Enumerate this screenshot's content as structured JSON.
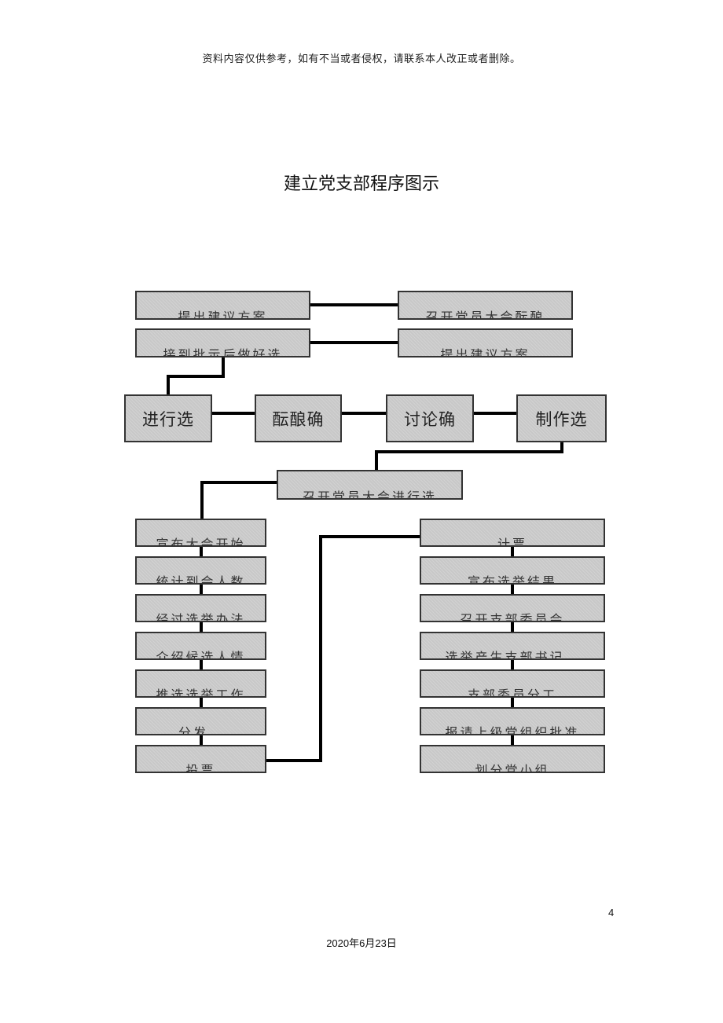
{
  "header_note": "资料内容仅供参考，如有不当或者侵权，请联系本人改正或者删除。",
  "title": "建立党支部程序图示",
  "flowchart": {
    "top_rows": [
      {
        "left": "提出建议方案",
        "right": "召开党员大会酝酿"
      },
      {
        "left": "接到批示后做好选",
        "right": "提出建议方案"
      }
    ],
    "main_row": [
      "进行选",
      "酝酿确",
      "讨论确",
      "制作选"
    ],
    "meeting": "召开党员大会进行选",
    "left_column": [
      "宣布大会开始",
      "统计到会人数",
      "经过选举办法",
      "介绍候选人情",
      "推选选举工作",
      "分发、",
      "投票"
    ],
    "right_column": [
      "计票",
      "宣布选举结果",
      "召开支部委员会",
      "选举产生支部书记、",
      "支部委员分工",
      "报请上级党组织批准",
      "划分党小组"
    ]
  },
  "footer": {
    "page_number": "4",
    "date": "2020年6月23日"
  }
}
